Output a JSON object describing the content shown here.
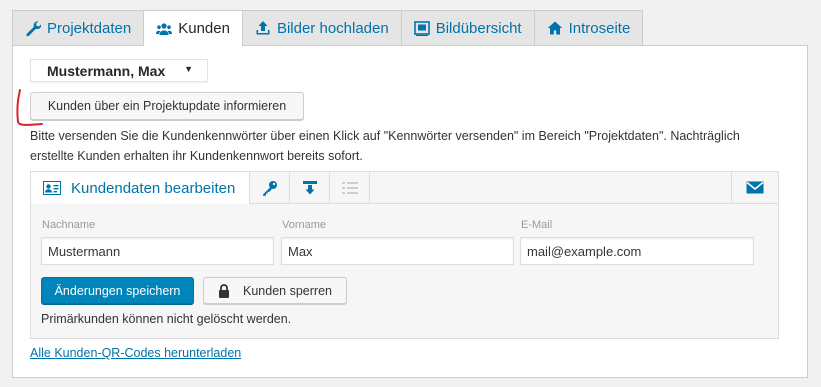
{
  "tabs": [
    {
      "label": "Projektdaten",
      "icon": "wrench-icon",
      "active": false
    },
    {
      "label": "Kunden",
      "icon": "users-icon",
      "active": true
    },
    {
      "label": "Bilder hochladen",
      "icon": "upload-icon",
      "active": false
    },
    {
      "label": "Bildübersicht",
      "icon": "gallery-icon",
      "active": false
    },
    {
      "label": "Introseite",
      "icon": "home-icon",
      "active": false
    }
  ],
  "customer_select": {
    "value": "Mustermann, Max"
  },
  "inform_button": {
    "label": "Kunden über ein Projektupdate informieren"
  },
  "notice": {
    "line1": "Bitte versenden Sie die Kundenkennwörter über einen Klick auf \"Kennwörter versenden\" im Bereich \"Projektdaten\". Nachträglich",
    "line2": "erstellte Kunden erhalten ihr Kundenkennwort bereits sofort."
  },
  "edit_box": {
    "title": "Kundendaten bearbeiten",
    "icons": [
      "id-card-icon",
      "key-icon",
      "download-icon",
      "list-icon",
      "mail-icon"
    ],
    "fields": {
      "lastname": {
        "label": "Nachname",
        "value": "Mustermann"
      },
      "firstname": {
        "label": "Vorname",
        "value": "Max"
      },
      "email": {
        "label": "E-Mail",
        "value": "mail@example.com"
      }
    },
    "save_label": "Änderungen speichern",
    "lock_label": "Kunden sperren",
    "note": "Primärkunden können nicht gelöscht werden."
  },
  "qr_link": "Alle Kunden-QR-Codes herunterladen",
  "colors": {
    "accent": "#0073aa",
    "button_primary": "#0085ba",
    "annotation": "#d9232d"
  }
}
